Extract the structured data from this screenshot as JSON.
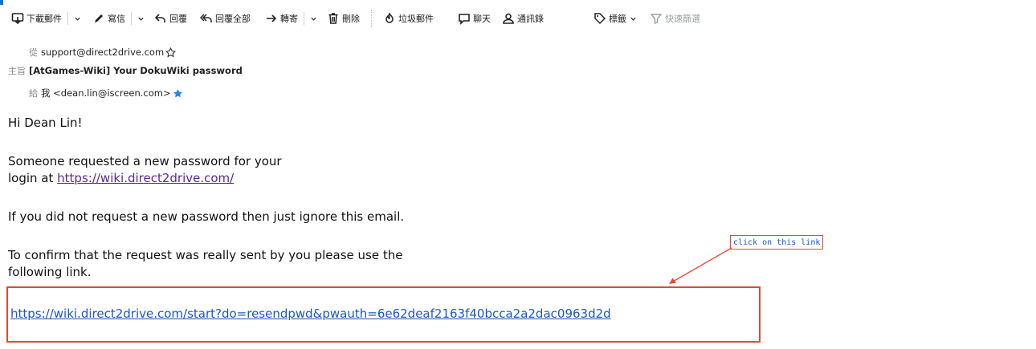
{
  "toolbar": {
    "download": "下載郵件",
    "compose": "寫信",
    "reply": "回覆",
    "reply_all": "回覆全部",
    "forward": "轉寄",
    "delete": "刪除",
    "junk": "垃圾郵件",
    "chat": "聊天",
    "contacts": "通訊錄",
    "tags": "標籤",
    "quick_filter": "快速篩選"
  },
  "headers": {
    "from_label": "從",
    "from_value": "support@direct2drive.com",
    "subject_label": "主旨",
    "subject_value": "[AtGames-Wiki] Your DokuWiki password",
    "to_label": "給",
    "to_value": "我 <dean.lin@iscreen.com>"
  },
  "email_body": {
    "greeting": "Hi Dean Lin!",
    "para1_line1": "Someone requested a new password for your",
    "para1_line2_prefix": "login at ",
    "wiki_link": "https://wiki.direct2drive.com/",
    "para2": "If you did not request a new password then just ignore this email.",
    "para3_line1": "To confirm that the request was really sent by you please use the",
    "para3_line2": "following link.",
    "reset_link": "https://wiki.direct2drive.com/start?do=resendpwd&pwauth=6e62deaf2163f40bcca2a2dac0963d2d"
  },
  "annotation": {
    "callout_text": "click on this link",
    "highlight_color": "#e8472f"
  },
  "icons": {
    "download": "download-icon",
    "compose": "pencil-icon",
    "reply": "reply-icon",
    "reply_all": "reply-all-icon",
    "forward": "forward-icon",
    "delete": "trash-icon",
    "junk": "junk-icon",
    "chat": "chat-icon",
    "contacts": "contacts-icon",
    "tags": "tag-icon",
    "quick_filter": "filter-icon",
    "star_outline": "star-outline-icon",
    "star_filled": "star-filled-icon"
  }
}
